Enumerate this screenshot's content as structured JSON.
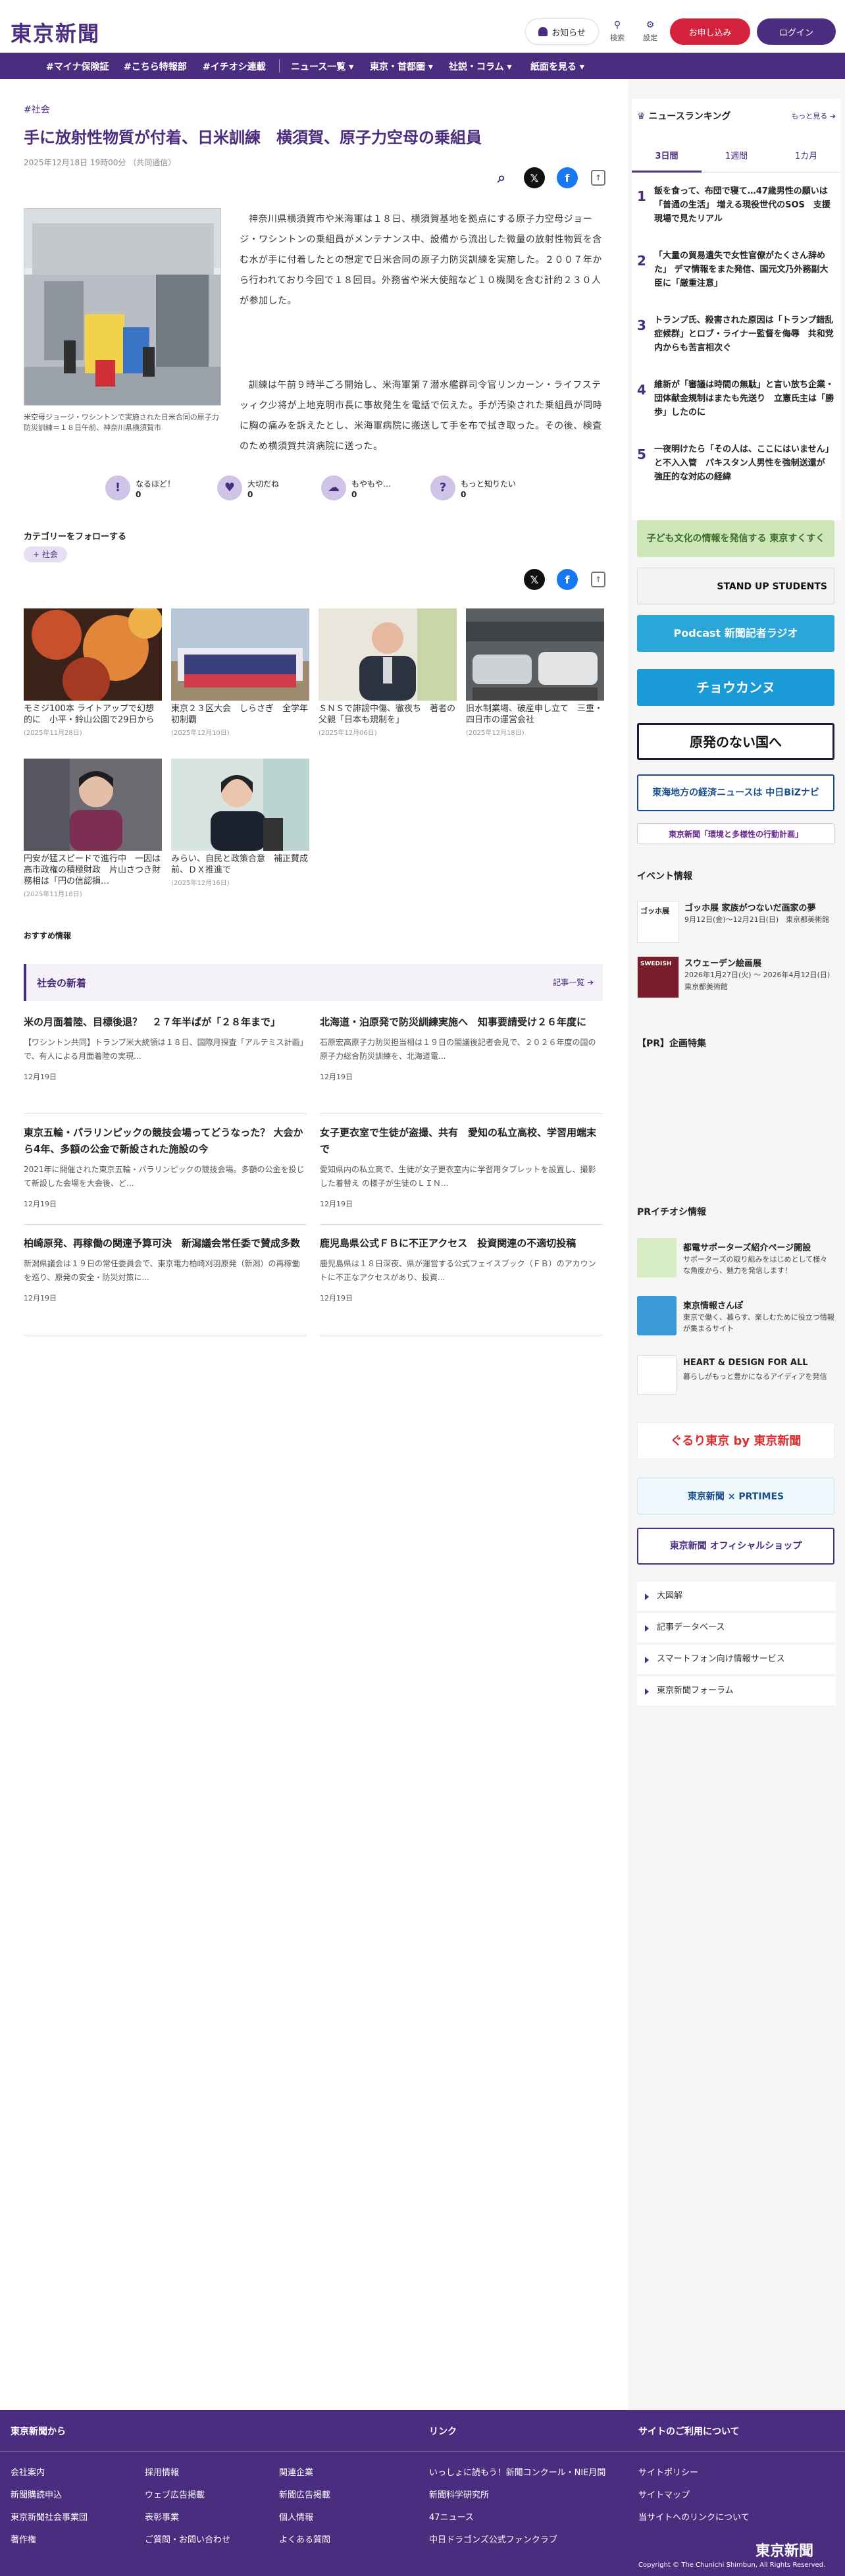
{
  "header": {
    "logo": "東京新聞",
    "notice_label": "お知らせ",
    "search_label": "検索",
    "settings_label": "設定",
    "apply_label": "お申し込み",
    "login_label": "ログイン"
  },
  "nav": [
    "#マイナ保険証",
    "#こちら特報部",
    "#イチオシ連載",
    "ニュース一覧",
    "東京・首都圏",
    "社説・コラム",
    "紙面を見る"
  ],
  "article": {
    "breadcrumb": "#社会",
    "title": "手に放射性物質が付着、日米訓練　横須賀、原子力空母の乗組員",
    "date": "2025年12月18日 19時00分 （共同通信）",
    "photo_caption": "米空母ジョージ・ワシントンで実施された日米合同の原子力防災訓練＝１８日午前、神奈川県横須賀市",
    "paragraphs": [
      "神奈川県横須賀市や米海軍は１８日、横須賀基地を拠点にする原子力空母ジョージ・ワシントンの乗組員がメンテナンス中、設備から流出した微量の放射性物質を含む水が手に付着したとの想定で日米合同の原子力防災訓練を実施した。２００７年から行われており今回で１８回目。外務省や米大使館など１０機関を含む計約２３０人が参加した。",
      "訓練は午前９時半ごろ開始し、米海軍第７潜水艦群司令官リンカーン・ライフステッィク少将が上地克明市長に事故発生を電話で伝えた。手が汚染された乗組員が同時に胸の痛みを訴えたとし、米海軍病院に搬送して手を布で拭き取った。その後、検査のため横須賀共済病院に送った。"
    ],
    "reactions": [
      {
        "label": "なるほど！",
        "count": "0"
      },
      {
        "label": "大切だね",
        "count": "0"
      },
      {
        "label": "もやもや…",
        "count": "0"
      },
      {
        "label": "もっと知りたい",
        "count": "0"
      }
    ],
    "follow_label": "カテゴリーをフォローする",
    "follow_tag": "社会"
  },
  "related": [
    {
      "title": "モミジ100本 ライトアップで幻想的に　小平・鈴山公園で29日から",
      "date": "(2025年11月28日)"
    },
    {
      "title": "東京２３区大会　しらさぎ　全学年初制覇",
      "date": "(2025年12月10日)"
    },
    {
      "title": "ＳＮＳで誹謗中傷、徹夜ち　著者の父親「日本も規制を」",
      "date": "(2025年12月06日)"
    },
    {
      "title": "旧水制業場、破産申し立て　三重・四日市の運営会社",
      "date": "(2025年12月18日)"
    },
    {
      "title": "円安が猛スピードで進行中　一因は高市政権の積極財政　片山さつき財務相は「円の信認損…",
      "date": "(2025年11月18日)"
    },
    {
      "title": "みらい、自民と政策合意　補正賛成前、ＤＸ推進で",
      "date": "(2025年12月16日)"
    }
  ],
  "recommend_label": "おすすめ情報",
  "society": {
    "heading": "社会の新着",
    "more": "記事一覧",
    "items": [
      {
        "title": "米の月面着陸、目標後退？　２７年半ばが「２８年まで」",
        "body": "【ワシントン共同】トランプ米大統領は１８日、国際月探査「アルテミス計画」で、有人による月面着陸の実現...",
        "date": "12月19日"
      },
      {
        "title": "北海道・泊原発で防災訓練実施へ　知事要請受け２６年度に",
        "body": "石原宏高原子力防災担当相は１９日の閣議後記者会見で、２０２６年度の国の原子力総合防災訓練を、北海道電...",
        "date": "12月19日"
      },
      {
        "title": "東京五輪・パラリンピックの競技会場ってどうなった？ 大会から4年、多額の公金で新設された施設の今",
        "body": "2021年に開催された東京五輪・パラリンピックの競技会場。多額の公金を投じて新設した会場を大会後、ど...",
        "date": "12月19日"
      },
      {
        "title": "女子更衣室で生徒が盗撮、共有　愛知の私立高校、学習用端末で",
        "body": "愛知県内の私立高で、生徒が女子更衣室内に学習用タブレットを設置し、撮影した着替え の様子が生徒のＬＩＮ...",
        "date": "12月19日"
      },
      {
        "title": "柏崎原発、再稼働の関連予算可決　新潟議会常任委で賛成多数",
        "body": "新潟県議会は１９日の常任委員会で、東京電力柏崎刈羽原発（新潟）の再稼働を巡り、原発の安全・防災対策に...",
        "date": "12月19日"
      },
      {
        "title": "鹿児島県公式ＦＢに不正アクセス　投資関連の不適切投稿",
        "body": "鹿児島県は１８日深夜、県が運営する公式フェイスブック（ＦＢ）のアカウントに不正なアクセスがあり、投資...",
        "date": "12月19日"
      }
    ]
  },
  "ranking": {
    "heading": "ニュースランキング",
    "more": "もっと見る",
    "tabs": [
      "3日間",
      "1週間",
      "1カ月"
    ],
    "items": [
      {
        "rank": "1",
        "title": "飯を食って、布団で寝て…47歳男性の願いは「普通の生活」 増える現役世代のSOS　支援現場で見たリアル"
      },
      {
        "rank": "2",
        "title": "「大量の貿易遺失で女性官僚がたくさん辞めた」 デマ情報をまた発信、国元文乃外務副大臣に「厳重注意」"
      },
      {
        "rank": "3",
        "title": "トランプ氏、殺害された原因は「トランプ錯乱症候群」とロブ・ライナー監督を侮辱　共和党内からも苦言相次ぐ"
      },
      {
        "rank": "4",
        "title": "維新が「審議は時間の無駄」と言い放ち企業・団体献金規制はまたも先送り　立憲氏主は「勝歩」したのに"
      },
      {
        "rank": "5",
        "title": "一夜明けたら「その人は、ここにはいません」と不入入管　パキスタン人男性を強制送還が　強圧的な対応の経緯"
      }
    ]
  },
  "banners": [
    "子ども文化の情報を発信する 東京すくすく",
    "STAND UP STUDENTS",
    "Podcast 新聞記者ラジオ",
    "チョウカンヌ",
    "原発のない国へ",
    "東海地方の経済ニュースは 中日BiZナビ",
    "東京新聞「環境と多様性の行動計画」"
  ],
  "events": {
    "heading": "イベント情報",
    "items": [
      {
        "title": "ゴッホ展 家族がつないだ画家の夢",
        "desc": "9月12日(金)〜12月21日(日)　東京都美術館",
        "thumb": "ゴッホ展"
      },
      {
        "title": "スウェーデン絵画展",
        "desc": "2026年1月27日(火) 〜 2026年4月12日(日)　東京都美術館",
        "thumb": "SWEDISH"
      }
    ]
  },
  "pr_heading": "【PR】企画特集",
  "pr_ichioshi": {
    "heading": "PRイチオシ情報",
    "items": [
      {
        "title": "都電サポーターズ紹介ページ開設",
        "desc": "サポーターズの取り組みをはじめとして様々な角度から、魅力を発信します！"
      },
      {
        "title": "東京情報さんぽ",
        "desc": "東京で働く、暮らす、楽しむために役立つ情報が集まるサイト"
      },
      {
        "title": "HEART & DESIGN FOR ALL",
        "desc": "暮らしがもっと豊かになるアイディアを発信"
      }
    ]
  },
  "side_banners2": [
    "ぐるり東京 by 東京新聞",
    "東京新聞 × PRTIMES",
    "東京新聞 オフィシャルショップ"
  ],
  "side_links": [
    "大図解",
    "記事データベース",
    "スマートフォン向け情報サービス",
    "東京新聞フォーラム"
  ],
  "footer": {
    "col1_heading": "東京新聞から",
    "col1": [
      "会社案内",
      "採用情報",
      "関連企業",
      "新聞購読申込",
      "ウェブ広告掲載",
      "新聞広告掲載",
      "東京新聞社会事業団",
      "表彰事業",
      "個人情報",
      "著作権",
      "ご質問・お問い合わせ",
      "よくある質問"
    ],
    "col2_heading": "リンク",
    "col2": [
      "いっしょに読もう！新聞コンクール・NIE月間",
      "新聞科学研究所",
      "47ニュース",
      "中日ドラゴンズ公式ファンクラブ"
    ],
    "col3_heading": "サイトのご利用について",
    "col3": [
      "サイトポリシー",
      "サイトマップ",
      "当サイトへのリンクについて"
    ],
    "logo": "東京新聞",
    "copyright": "Copyright © The Chunichi Shimbun, All Rights Reserved."
  },
  "colors": {
    "brand": "#4b2d7f",
    "apply": "#d4213d",
    "x": "#111111",
    "facebook": "#1877f2"
  }
}
